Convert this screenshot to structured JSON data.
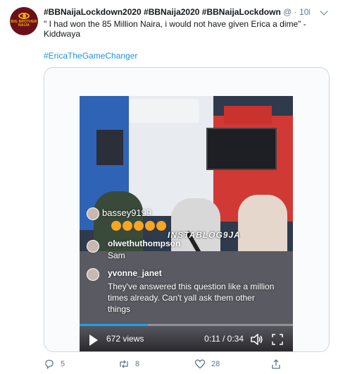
{
  "tweet": {
    "header": {
      "name": "#BBNaijaLockdown2020 #BBNaija2020 #BBNaijaLockdown",
      "handle": "@",
      "separator": "·",
      "time": "10h"
    },
    "avatar_brand": "BIG BROTHER NAIJA",
    "text_line1": "\" I had won the 85 Million Naira, i would not have given Erica a dime\" -",
    "text_line2": "Kiddwaya",
    "hashtag": "#EricaTheGameChanger",
    "video": {
      "watermark": "INSTABLOG9JA",
      "comments": [
        {
          "user": "bassey9199",
          "text": ""
        },
        {
          "user": "olwethuthompson",
          "text": "Sam"
        },
        {
          "user": "yvonne_janet",
          "text": "They've answered this question like a million times already. Can't yall ask them other things"
        }
      ],
      "views": "672 views",
      "time": "0:11 / 0:34",
      "progress": 0.32
    },
    "actions": {
      "replies": "5",
      "retweets": "8",
      "likes": "28"
    },
    "colors": {
      "link": "#1b95e0",
      "muted": "#657786",
      "progress": "#1da1f2"
    }
  }
}
